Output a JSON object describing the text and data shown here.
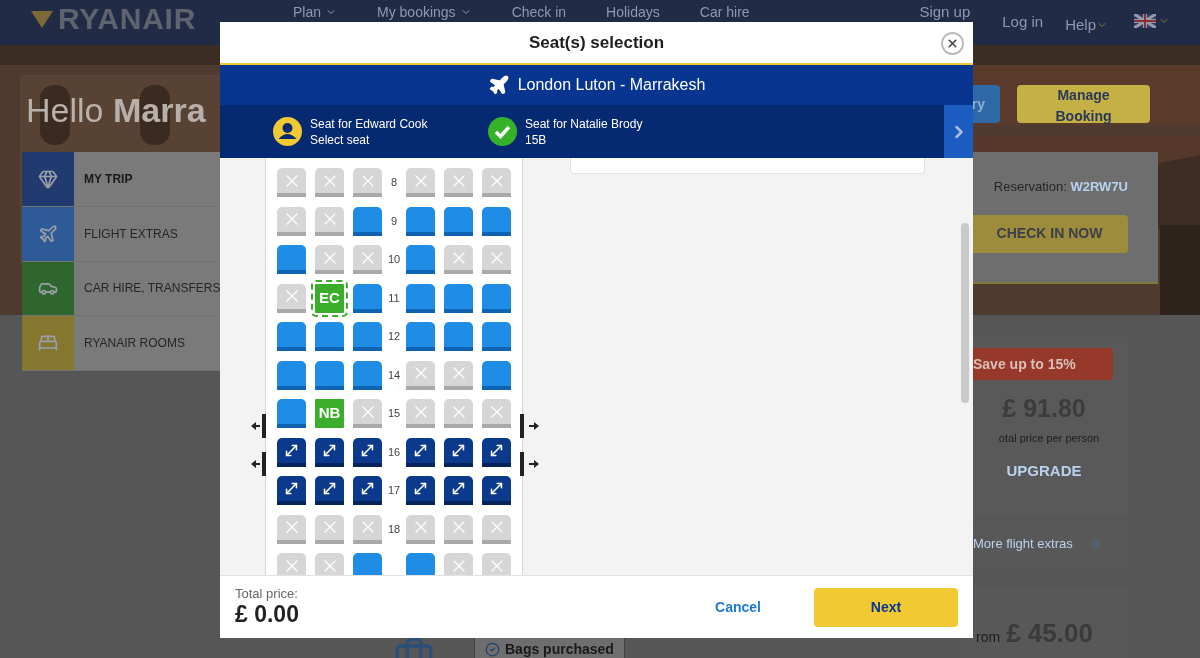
{
  "nav": {
    "logo": "RYANAIR",
    "items": [
      {
        "label": "Plan",
        "dropdown": true
      },
      {
        "label": "My bookings",
        "dropdown": true
      },
      {
        "label": "Check in",
        "dropdown": false
      },
      {
        "label": "Holidays",
        "dropdown": false
      },
      {
        "label": "Car hire",
        "dropdown": false
      }
    ],
    "account": [
      "Sign up",
      "Log in"
    ],
    "help": "Help"
  },
  "hero": {
    "greeting": "Hello",
    "name": "Marra",
    "buttons": [
      {
        "label": "ry",
        "kind": "secondary"
      },
      {
        "label": "Manage Booking",
        "kind": "primary"
      }
    ]
  },
  "trip_menu": [
    {
      "label": "MY TRIP",
      "selected": true,
      "color": "#213b70"
    },
    {
      "label": "FLIGHT EXTRAS",
      "selected": false,
      "color": "#2e5b98"
    },
    {
      "label": "CAR HIRE, TRANSFERS",
      "selected": false,
      "color": "#2f662f"
    },
    {
      "label": "RYANAIR ROOMS",
      "selected": false,
      "color": "#857630"
    }
  ],
  "reservation": {
    "label": "Reservation:",
    "code": "W2RW7U",
    "button": "CHECK IN NOW"
  },
  "upgrade_card": {
    "badge": "Save up to 15%",
    "price": "£ 91.80",
    "caption": "otal price per person",
    "link": "UPGRADE"
  },
  "extras_link": "More flight extras",
  "bags_card": {
    "prefix": "rom",
    "price": "£ 45.00"
  },
  "bags_badge": "Bags purchased",
  "modal": {
    "title": "Seat(s) selection",
    "route": "London Luton - Marrakesh",
    "passengers": [
      {
        "name": "Seat for Edward Cook",
        "status": "Select seat",
        "done": false
      },
      {
        "name": "Seat for Natalie Brody",
        "status": "15B",
        "done": true
      }
    ],
    "seat_rows": [
      {
        "row": "8",
        "exit": false,
        "seats": [
          {
            "kind": "unavailable"
          },
          {
            "kind": "unavailable"
          },
          {
            "kind": "unavailable"
          },
          {
            "kind": "unavailable"
          },
          {
            "kind": "unavailable"
          },
          {
            "kind": "unavailable"
          }
        ]
      },
      {
        "row": "9",
        "exit": false,
        "seats": [
          {
            "kind": "unavailable"
          },
          {
            "kind": "unavailable"
          },
          {
            "kind": "standard"
          },
          {
            "kind": "standard"
          },
          {
            "kind": "standard"
          },
          {
            "kind": "standard"
          }
        ]
      },
      {
        "row": "10",
        "exit": false,
        "seats": [
          {
            "kind": "standard"
          },
          {
            "kind": "unavailable"
          },
          {
            "kind": "unavailable"
          },
          {
            "kind": "standard"
          },
          {
            "kind": "unavailable"
          },
          {
            "kind": "unavailable"
          }
        ]
      },
      {
        "row": "11",
        "exit": false,
        "seats": [
          {
            "kind": "unavailable"
          },
          {
            "kind": "assigned",
            "label": "EC",
            "selected": true
          },
          {
            "kind": "standard"
          },
          {
            "kind": "standard"
          },
          {
            "kind": "standard"
          },
          {
            "kind": "standard"
          }
        ]
      },
      {
        "row": "12",
        "exit": false,
        "seats": [
          {
            "kind": "standard"
          },
          {
            "kind": "standard"
          },
          {
            "kind": "standard"
          },
          {
            "kind": "standard"
          },
          {
            "kind": "standard"
          },
          {
            "kind": "standard"
          }
        ]
      },
      {
        "row": "14",
        "exit": false,
        "seats": [
          {
            "kind": "standard"
          },
          {
            "kind": "standard"
          },
          {
            "kind": "standard"
          },
          {
            "kind": "unavailable"
          },
          {
            "kind": "unavailable"
          },
          {
            "kind": "standard"
          }
        ]
      },
      {
        "row": "15",
        "exit": false,
        "seats": [
          {
            "kind": "standard"
          },
          {
            "kind": "assigned",
            "label": "NB",
            "selected": false
          },
          {
            "kind": "unavailable"
          },
          {
            "kind": "unavailable"
          },
          {
            "kind": "unavailable"
          },
          {
            "kind": "unavailable"
          }
        ]
      },
      {
        "row": "16",
        "exit": true,
        "seats": [
          {
            "kind": "extra_legroom"
          },
          {
            "kind": "extra_legroom"
          },
          {
            "kind": "extra_legroom"
          },
          {
            "kind": "extra_legroom"
          },
          {
            "kind": "extra_legroom"
          },
          {
            "kind": "extra_legroom"
          }
        ]
      },
      {
        "row": "17",
        "exit": true,
        "seats": [
          {
            "kind": "extra_legroom"
          },
          {
            "kind": "extra_legroom"
          },
          {
            "kind": "extra_legroom"
          },
          {
            "kind": "extra_legroom"
          },
          {
            "kind": "extra_legroom"
          },
          {
            "kind": "extra_legroom"
          }
        ]
      },
      {
        "row": "18",
        "exit": false,
        "seats": [
          {
            "kind": "unavailable"
          },
          {
            "kind": "unavailable"
          },
          {
            "kind": "unavailable"
          },
          {
            "kind": "unavailable"
          },
          {
            "kind": "unavailable"
          },
          {
            "kind": "unavailable"
          }
        ]
      },
      {
        "exit": false,
        "seats": [
          {
            "kind": "unavailable"
          },
          {
            "kind": "unavailable"
          },
          {
            "kind": "standard"
          },
          {
            "kind": "standard"
          },
          {
            "kind": "unavailable"
          },
          {
            "kind": "unavailable"
          }
        ]
      }
    ],
    "total_label": "Total price:",
    "total": "£ 0.00",
    "cancel": "Cancel",
    "next": "Next"
  }
}
